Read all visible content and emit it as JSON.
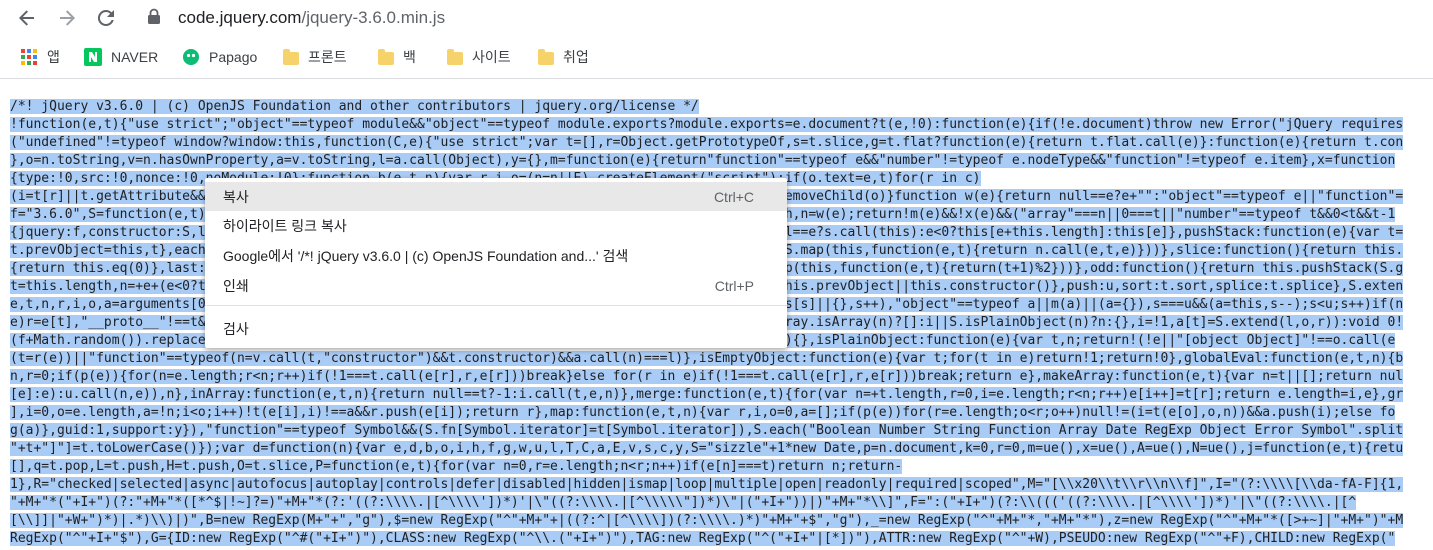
{
  "browser": {
    "url_host": "code.jquery.com",
    "url_path": "/jquery-3.6.0.min.js",
    "bookmarks": [
      {
        "label": "앱",
        "icon": "apps-grid-icon"
      },
      {
        "label": "NAVER",
        "icon": "naver-icon"
      },
      {
        "label": "Papago",
        "icon": "papago-icon"
      },
      {
        "label": "프론트",
        "icon": "folder-icon"
      },
      {
        "label": "백",
        "icon": "folder-icon"
      },
      {
        "label": "사이트",
        "icon": "folder-icon"
      },
      {
        "label": "취업",
        "icon": "folder-icon"
      }
    ]
  },
  "code_lines": [
    "/*! jQuery v3.6.0 | (c) OpenJS Foundation and other contributors | jquery.org/license */",
    "!function(e,t){\"use strict\";\"object\"==typeof module&&\"object\"==typeof module.exports?module.exports=e.document?t(e,!0):function(e){if(!e.document)throw new Error(\"jQuery requires",
    "(\"undefined\"!=typeof window?window:this,function(C,e){\"use strict\";var t=[],r=Object.getPrototypeOf,s=t.slice,g=t.flat?function(e){return t.flat.call(e)}:function(e){return t.con",
    "},o=n.toString,v=n.hasOwnProperty,a=v.toString,l=a.call(Object),y={},m=function(e){return\"function\"==typeof e&&\"number\"!=typeof e.nodeType&&\"function\"!=typeof e.item},x=function",
    "{type:!0,src:!0,nonce:!0,noModule:!0};function b(e,t,n){var r,i,o=(n=n||E).createElement(\"script\");if(o.text=e,t)for(r in c)",
    "(i=t[r]||t.getAttribute&&t.getAttribute(r))&&o.setAttribute(r,i);n.head.appendChild(o).parentNode.removeChild(o)}function w(e){return null==e?e+\"\":\"object\"==typeof e||\"function\"=",
    "f=\"3.6.0\",S=function(e,t){return new S.fn.init(e,t)};function p(e){var t=!!e&&\"length\"in e&&e.length,n=w(e);return!m(e)&&!x(e)&&(\"array\"===n||0===t||\"number\"==typeof t&&0<t&&t-1",
    "{jquery:f,constructor:S,length:0,toArray:function(){return s.call(this)},get:function(e){return null==e?s.call(this):e<0?this[e+this.length]:this[e]},pushStack:function(e){var t=",
    "t.prevObject=this,t},each:function(e){return S.each(this,e)},map:function(n){return this.pushStack(S.map(this,function(e,t){return n.call(e,t,e)}))},slice:function(){return this.",
    "{return this.eq(0)},last:function(){return this.eq(-1)},even:function(){return this.pushStack(S.grep(this,function(e,t){return(t+1)%2}))},odd:function(){return this.pushStack(S.g",
    "t=this.length,n=+e+(e<0?t:0);return this.pushStack(0<=n&&n<t?[this[n]]:[])},end:function(){return this.prevObject||this.constructor()},push:u,sort:t.sort,splice:t.splice},S.exten",
    "e,t,n,r,i,o,a=arguments[0]||{},s=1,u=arguments.length,l=!1;for(\"boolean\"==typeof a&&(l=a,a=arguments[s]||{},s++),\"object\"==typeof a||m(a)||(a={}),s===u&&(a=this,s--);s<u;s++)if(n",
    "e)r=e[t],\"__proto__\"!==t&&a!==r&&(l&&r&&(S.isPlainObject(r)||(i=Array.isArray(r)))?(n=a[t],o=i&&!Array.isArray(n)?[]:i||S.isPlainObject(n)?n:{},i=!1,a[t]=S.extend(l,o,r)):void 0!",
    "(f+Math.random()).replace(/\\D/g,\"\"),isReady:!0,error:function(e){throw new Error(e)},noop:function(){},isPlainObject:function(e){var t,n;return!(!e||\"[object Object]\"!==o.call(e",
    "(t=r(e))||\"function\"==typeof(n=v.call(t,\"constructor\")&&t.constructor)&&a.call(n)===l)},isEmptyObject:function(e){var t;for(t in e)return!1;return!0},globalEval:function(e,t,n){b",
    "n,r=0;if(p(e)){for(n=e.length;r<n;r++)if(!1===t.call(e[r],r,e[r]))break}else for(r in e)if(!1===t.call(e[r],r,e[r]))break;return e},makeArray:function(e,t){var n=t||[];return nul",
    "[e]:e):u.call(n,e)),n},inArray:function(e,t,n){return null==t?-1:i.call(t,e,n)},merge:function(e,t){for(var n=+t.length,r=0,i=e.length;r<n;r++)e[i++]=t[r];return e.length=i,e},gr",
    "],i=0,o=e.length,a=!n;i<o;i++)!t(e[i],i)!==a&&r.push(e[i]);return r},map:function(e,t,n){var r,i,o=0,a=[];if(p(e))for(r=e.length;o<r;o++)null!=(i=t(e[o],o,n))&&a.push(i);else fo",
    "g(a)},guid:1,support:y}),\"function\"==typeof Symbol&&(S.fn[Symbol.iterator]=t[Symbol.iterator]),S.each(\"Boolean Number String Function Array Date RegExp Object Error Symbol\".split",
    "\"+t+\"]\"]=t.toLowerCase()});var d=function(n){var e,d,b,o,i,h,f,g,w,u,l,T,C,a,E,v,s,c,y,S=\"sizzle\"+1*new Date,p=n.document,k=0,r=0,m=ue(),x=ue(),A=ue(),N=ue(),j=function(e,t){retu",
    "[],q=t.pop,L=t.push,H=t.push,O=t.slice,P=function(e,t){for(var n=0,r=e.length;n<r;n++)if(e[n]===t)return n;return-",
    "1},R=\"checked|selected|async|autofocus|autoplay|controls|defer|disabled|hidden|ismap|loop|multiple|open|readonly|required|scoped\",M=\"[\\\\x20\\\\t\\\\r\\\\n\\\\f]\",I=\"(?:\\\\\\\\[\\\\da-fA-F]{1,",
    "\"+M+\"*(\"+I+\")(?:\"+M+\"*([*^$|!~]?=)\"+M+\"*(?:'((?:\\\\\\\\.|[^\\\\\\\\'])*)'|\\\"((?:\\\\\\\\.|[^\\\\\\\\\\\"])*)\\\"|(\"+I+\"))|)\"+M+\"*\\\\]\",F=\":(\"+I+\")(?:\\\\((('((?:\\\\\\\\.|[^\\\\\\\\'])*)'|\\\"((?:\\\\\\\\.|[^",
    "[\\\\]]|\"+W+\")*)|.*)\\\\)|)\",B=new RegExp(M+\"+\",\"g\"),$=new RegExp(\"^\"+M+\"+|((?:^|[^\\\\\\\\])(?:\\\\\\\\.)*)\"+M+\"+$\",\"g\"),_=new RegExp(\"^\"+M+\"*,\"+M+\"*\"),z=new RegExp(\"^\"+M+\"*([>+~]|\"+M+\")\"+M",
    "RegExp(\"^\"+I+\"$\"),G={ID:new RegExp(\"^#(\"+I+\")\"),CLASS:new RegExp(\"^\\\\.(\"+I+\")\"),TAG:new RegExp(\"^(\"+I+\"|[*])\"),ATTR:new RegExp(\"^\"+W),PSEUDO:new RegExp(\"^\"+F),CHILD:new RegExp(\""
  ],
  "context_menu": {
    "copy": {
      "label": "복사",
      "shortcut": "Ctrl+C"
    },
    "copy_highlight_link": {
      "label": "하이라이트 링크 복사"
    },
    "search_google": {
      "label": "Google에서 '/*! jQuery v3.6.0 | (c) OpenJS Foundation and...' 검색"
    },
    "print": {
      "label": "인쇄",
      "shortcut": "Ctrl+P"
    },
    "inspect": {
      "label": "검사"
    }
  }
}
